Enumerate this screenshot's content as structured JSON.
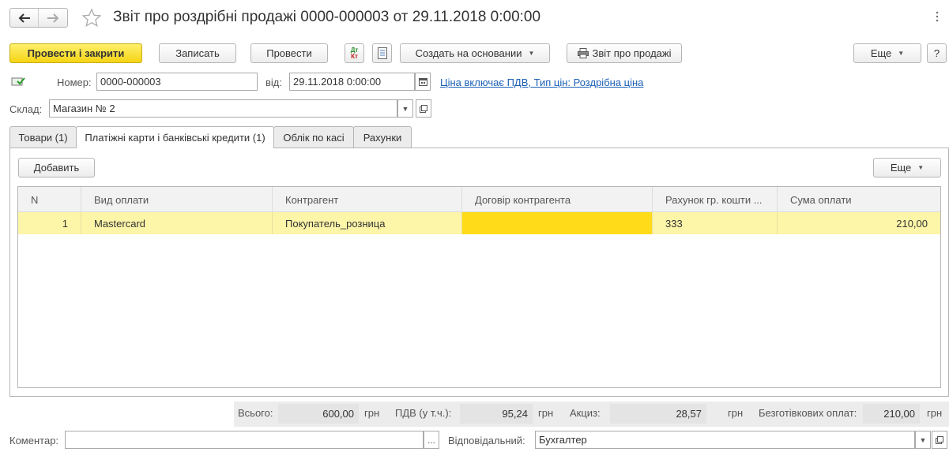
{
  "window": {
    "title": "Звіт про роздрібні продажі 0000-000003 от 29.11.2018 0:00:00"
  },
  "toolbar": {
    "post_and_close": "Провести і закрити",
    "save": "Записать",
    "post": "Провести",
    "create_based_on": "Создать на основании",
    "sales_report": "Звіт про продажі",
    "more": "Еще",
    "help": "?",
    "dt_kt_top": "Дт",
    "dt_kt_bottom": "Кт"
  },
  "header": {
    "number_label": "Номер:",
    "number_value": "0000-000003",
    "date_label": "від:",
    "date_value": "29.11.2018  0:00:00",
    "price_link": "Ціна включає ПДВ, Тип цін: Роздрібна ціна",
    "warehouse_label": "Склад:",
    "warehouse_value": "Магазин № 2"
  },
  "tabs": [
    {
      "label": "Товари (1)"
    },
    {
      "label": "Платіжні карти і банківські кредити (1)"
    },
    {
      "label": "Облік по касі"
    },
    {
      "label": "Рахунки"
    }
  ],
  "table_toolbar": {
    "add": "Добавить",
    "more": "Еще"
  },
  "table": {
    "columns": [
      "N",
      "Вид оплати",
      "Контрагент",
      "Договір контрагента",
      "Рахунок гр. кошти ...",
      "Сума оплати"
    ],
    "rows": [
      {
        "n": "1",
        "payment_type": "Mastercard",
        "counterparty": "Покупатель_розница",
        "contract": "",
        "account": "333",
        "amount": "210,00"
      }
    ]
  },
  "totals": {
    "total_label": "Всього:",
    "total_value": "600,00",
    "total_cur": "грн",
    "vat_label": "ПДВ (у т.ч.):",
    "vat_value": "95,24",
    "vat_cur": "грн",
    "excise_label": "Акциз:",
    "excise_value": "28,57",
    "excise_cur": "грн",
    "noncash_label": "Безготівкових оплат:",
    "noncash_value": "210,00",
    "noncash_cur": "грн"
  },
  "footer": {
    "comment_label": "Коментар:",
    "comment_value": "",
    "comment_button": "...",
    "responsible_label": "Відповідальний:",
    "responsible_value": "Бухгалтер"
  },
  "colors": {
    "primary_button": "#f5d416",
    "selected_row": "#fdf5a8",
    "highlighted_cell": "#ffdb1a",
    "link": "#1a5fb4"
  }
}
